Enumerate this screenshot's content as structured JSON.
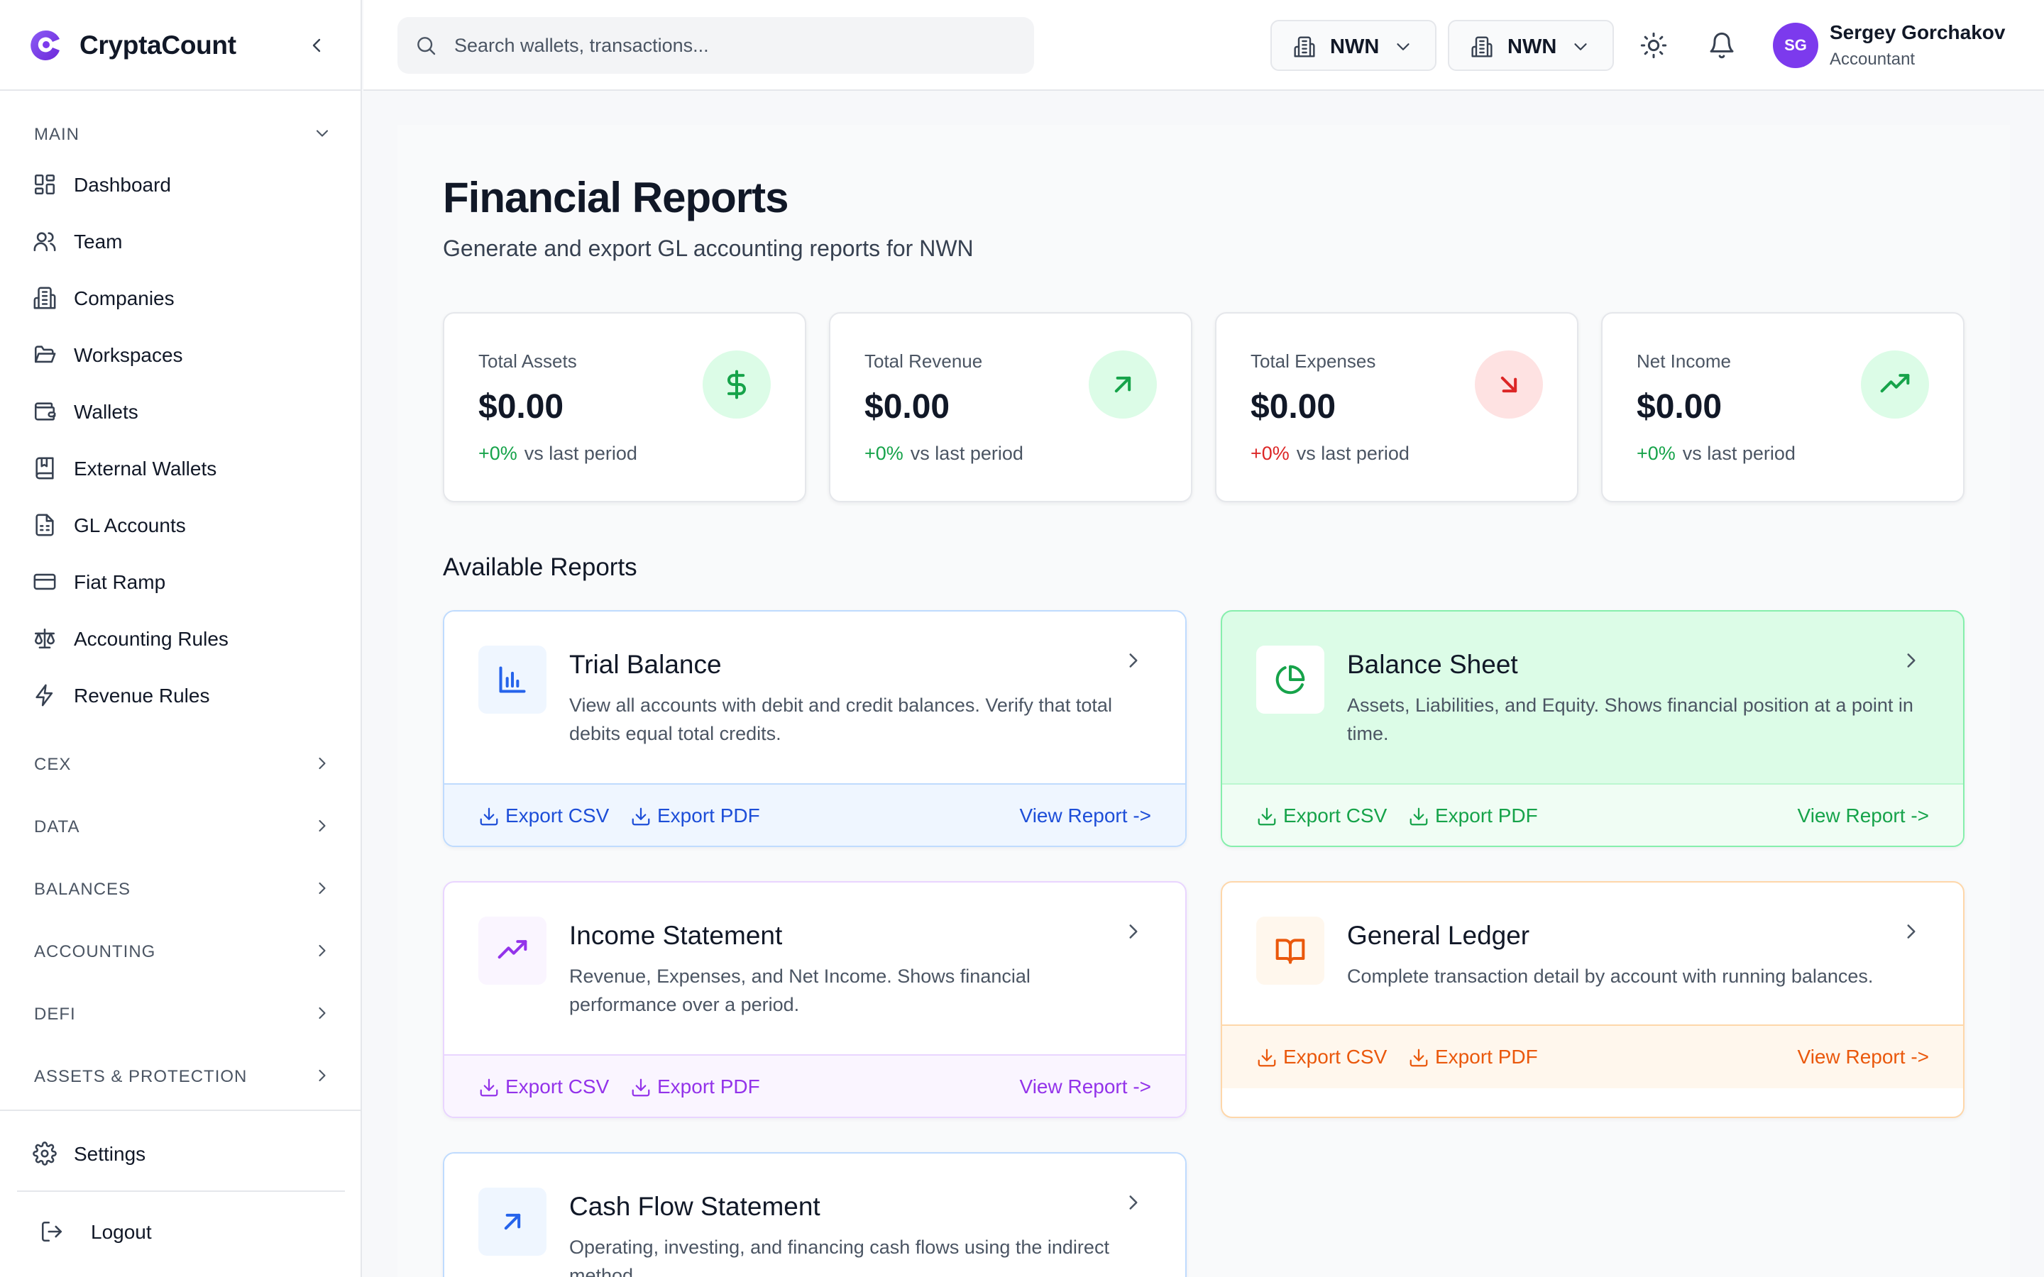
{
  "app": {
    "name": "CryptaCount"
  },
  "search": {
    "placeholder": "Search wallets, transactions..."
  },
  "selectors": [
    {
      "label": "NWN"
    },
    {
      "label": "NWN"
    }
  ],
  "user": {
    "initials": "SG",
    "name": "Sergey Gorchakov",
    "role": "Accountant"
  },
  "sidebar": {
    "main_section": "MAIN",
    "main_items": [
      {
        "label": "Dashboard",
        "icon": "dashboard-icon"
      },
      {
        "label": "Team",
        "icon": "users-icon"
      },
      {
        "label": "Companies",
        "icon": "building-icon"
      },
      {
        "label": "Workspaces",
        "icon": "folder-icon"
      },
      {
        "label": "Wallets",
        "icon": "wallet-icon"
      },
      {
        "label": "External Wallets",
        "icon": "book-icon"
      },
      {
        "label": "GL Accounts",
        "icon": "spreadsheet-icon"
      },
      {
        "label": "Fiat Ramp",
        "icon": "credit-card-icon"
      },
      {
        "label": "Accounting Rules",
        "icon": "scale-icon"
      },
      {
        "label": "Revenue Rules",
        "icon": "lightning-icon"
      }
    ],
    "sections": [
      "CEX",
      "DATA",
      "BALANCES",
      "ACCOUNTING",
      "DEFI",
      "ASSETS & PROTECTION"
    ],
    "settings": "Settings",
    "logout": "Logout"
  },
  "page": {
    "title": "Financial Reports",
    "subtitle": "Generate and export GL accounting reports for NWN"
  },
  "stats": [
    {
      "label": "Total Assets",
      "value": "$0.00",
      "change": "+0%",
      "change_suffix": "vs last period",
      "trend": "positive",
      "icon": "dollar-icon",
      "color": "#16a34a"
    },
    {
      "label": "Total Revenue",
      "value": "$0.00",
      "change": "+0%",
      "change_suffix": "vs last period",
      "trend": "positive",
      "icon": "arrow-up-right-icon",
      "color": "#16a34a"
    },
    {
      "label": "Total Expenses",
      "value": "$0.00",
      "change": "+0%",
      "change_suffix": "vs last period",
      "trend": "negative",
      "icon": "arrow-down-right-icon",
      "color": "#dc2626"
    },
    {
      "label": "Net Income",
      "value": "$0.00",
      "change": "+0%",
      "change_suffix": "vs last period",
      "trend": "positive",
      "icon": "trending-up-icon",
      "color": "#16a34a"
    }
  ],
  "reports_heading": "Available Reports",
  "reports": [
    {
      "title": "Trial Balance",
      "description": "View all accounts with debit and credit balances. Verify that total debits equal total credits.",
      "export_csv": "Export CSV",
      "export_pdf": "Export PDF",
      "view": "View Report ->",
      "icon": "bar-chart-icon",
      "accent": "#2563eb"
    },
    {
      "title": "Balance Sheet",
      "description": "Assets, Liabilities, and Equity. Shows financial position at a point in time.",
      "export_csv": "Export CSV",
      "export_pdf": "Export PDF",
      "view": "View Report ->",
      "icon": "pie-chart-icon",
      "accent": "#16a34a"
    },
    {
      "title": "Income Statement",
      "description": "Revenue, Expenses, and Net Income. Shows financial performance over a period.",
      "export_csv": "Export CSV",
      "export_pdf": "Export PDF",
      "view": "View Report ->",
      "icon": "trending-up-icon",
      "accent": "#9333ea"
    },
    {
      "title": "General Ledger",
      "description": "Complete transaction detail by account with running balances.",
      "export_csv": "Export CSV",
      "export_pdf": "Export PDF",
      "view": "View Report ->",
      "icon": "open-book-icon",
      "accent": "#ea580c"
    },
    {
      "title": "Cash Flow Statement",
      "description": "Operating, investing, and financing cash flows using the indirect method.",
      "icon": "arrow-up-right-icon",
      "accent": "#2563eb"
    }
  ]
}
